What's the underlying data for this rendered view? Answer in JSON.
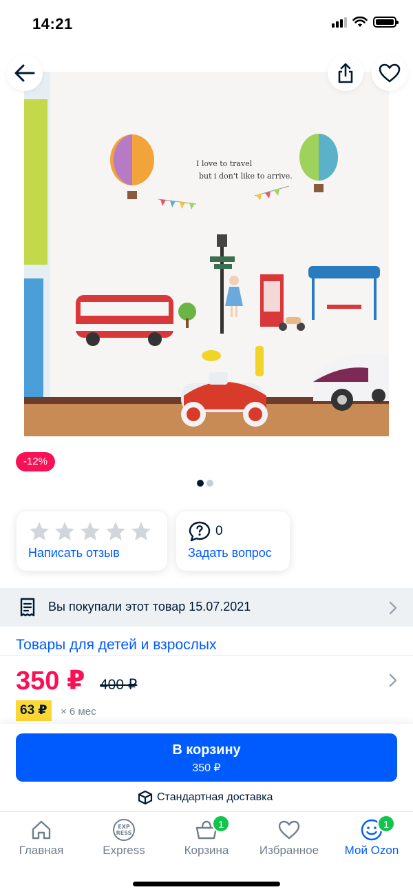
{
  "status_bar": {
    "time": "14:21"
  },
  "product": {
    "image_text_line1": "I love to travel",
    "image_text_line2": "but i don't like to arrive.",
    "discount_badge": "-12%",
    "gallery_total": 2,
    "gallery_active": 1
  },
  "reviews": {
    "link_label": "Написать отзыв",
    "stars_filled": 0,
    "stars_total": 5
  },
  "questions": {
    "count": "0",
    "link_label": "Задать вопрос"
  },
  "purchase_notice": {
    "text": "Вы покупали этот товар 15.07.2021"
  },
  "category": {
    "label": "Товары для детей и взрослых"
  },
  "pricing": {
    "price": "350 ₽",
    "old_price": "400 ₽",
    "installment_amount": "63 ₽",
    "installment_term": "× 6 мес"
  },
  "cart_button": {
    "label": "В корзину",
    "price": "350 ₽"
  },
  "delivery": {
    "label": "Стандартная доставка"
  },
  "tabbar": {
    "items": [
      {
        "label": "Главная",
        "icon": "home-icon"
      },
      {
        "label": "Express",
        "icon": "express-icon",
        "icon_text_top": "EXP",
        "icon_text_bottom": "RESS"
      },
      {
        "label": "Корзина",
        "icon": "cart-icon",
        "badge": "1"
      },
      {
        "label": "Избранное",
        "icon": "heart-icon"
      },
      {
        "label": "Мой Ozon",
        "icon": "profile-icon",
        "badge": "1",
        "active": true
      }
    ]
  },
  "colors": {
    "accent": "#005bff",
    "discount": "#f91155",
    "badge_green": "#10c44c",
    "installment_yellow": "#fdd835"
  }
}
